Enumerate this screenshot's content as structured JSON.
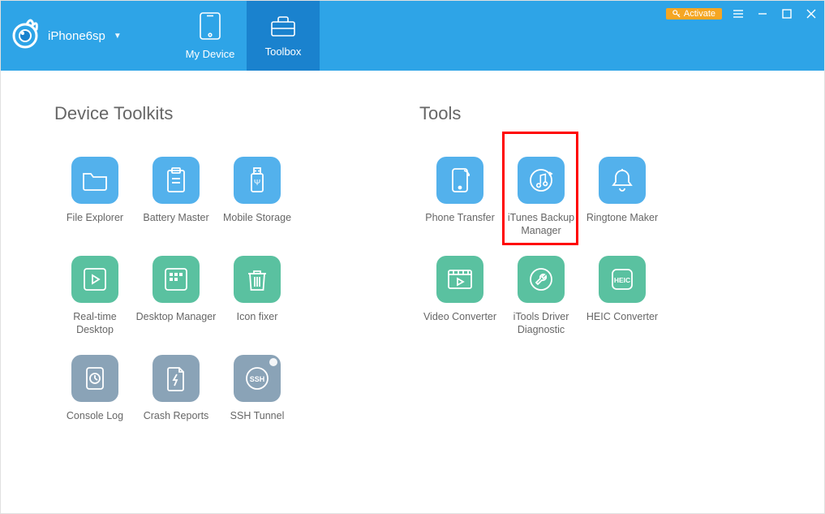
{
  "header": {
    "device_name": "iPhone6sp",
    "tab_my_device": "My Device",
    "tab_toolbox": "Toolbox",
    "activate": "Activate"
  },
  "sections": {
    "device_toolkits": {
      "title": "Device Toolkits",
      "items": [
        {
          "label": "File Explorer"
        },
        {
          "label": "Battery Master"
        },
        {
          "label": "Mobile Storage"
        },
        {
          "label": "Real-time Desktop"
        },
        {
          "label": "Desktop Manager"
        },
        {
          "label": "Icon fixer"
        },
        {
          "label": "Console Log"
        },
        {
          "label": "Crash Reports"
        },
        {
          "label": "SSH Tunnel"
        }
      ]
    },
    "tools": {
      "title": "Tools",
      "items": [
        {
          "label": "Phone Transfer"
        },
        {
          "label": "iTunes Backup Manager"
        },
        {
          "label": "Ringtone Maker"
        },
        {
          "label": "Video Converter"
        },
        {
          "label": "iTools Driver Diagnostic"
        },
        {
          "label": "HEIC Converter"
        }
      ]
    }
  },
  "colors": {
    "primary": "#2ea4e7",
    "primary_dark": "#1a82ce",
    "green": "#5ac1a0",
    "gray": "#8aa3b7",
    "activate": "#f5a623",
    "highlight": "#ff0000"
  }
}
